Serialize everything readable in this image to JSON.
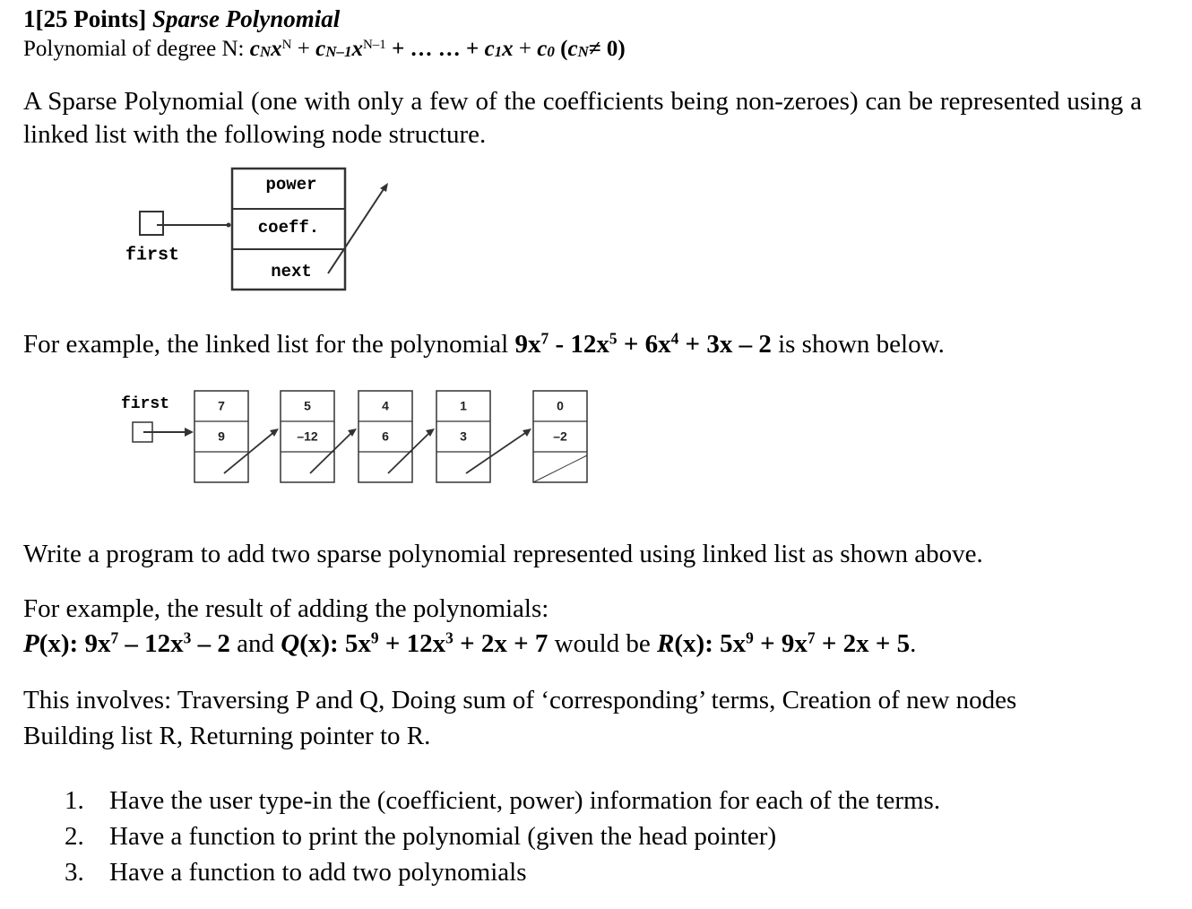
{
  "header": {
    "number": "1",
    "points": "[25 Points]",
    "title": "Sparse Polynomial"
  },
  "definition": {
    "prefix": "Polynomial of degree N: ",
    "terms": [
      {
        "coef": "c",
        "coef_sub": "N",
        "var": "x",
        "exp": "N",
        "sep": " + "
      },
      {
        "coef": "c",
        "coef_sub": "N–1",
        "var": "x",
        "exp": "N–1",
        "sep": " + … … + "
      },
      {
        "coef": "c",
        "coef_sub": "1",
        "var": "x",
        "exp": "",
        "sep": " + "
      },
      {
        "coef": "c",
        "coef_sub": "0",
        "var": "",
        "exp": "",
        "sep": ""
      }
    ],
    "condition_open": " (",
    "condition_coef": "c",
    "condition_sub": "N",
    "condition_rest": "≠ 0)"
  },
  "intro_paragraph": "A Sparse Polynomial (one with only a few of the coefficients being non-zeroes) can be represented using a linked list with the following node structure.",
  "node_structure": {
    "pointer_label": "first",
    "fields": [
      "power",
      "coeff.",
      "next"
    ]
  },
  "example": {
    "before": "For example, the linked list for the polynomial ",
    "terms": [
      {
        "coef": "9x",
        "exp": "7",
        "sep": " - "
      },
      {
        "coef": "12x",
        "exp": "5",
        "sep": " + "
      },
      {
        "coef": "6x",
        "exp": "4",
        "sep": " + "
      },
      {
        "coef": "3x",
        "exp": "",
        "sep": " – "
      },
      {
        "coef": "2",
        "exp": "",
        "sep": ""
      }
    ],
    "after": " is shown below."
  },
  "example_list": {
    "pointer_label": "first",
    "nodes": [
      {
        "power": "7",
        "coeff": "9",
        "next": "pointer"
      },
      {
        "power": "5",
        "coeff": "–12",
        "next": "pointer"
      },
      {
        "power": "4",
        "coeff": "6",
        "next": "pointer"
      },
      {
        "power": "1",
        "coeff": "3",
        "next": "pointer"
      },
      {
        "power": "0",
        "coeff": "–2",
        "next": "null"
      }
    ]
  },
  "task": "Write a program to add two sparse polynomial represented using linked list as shown above.",
  "sum_example": {
    "intro": "For example, the result of adding the polynomials:",
    "p_name": "P",
    "p_expr": [
      "9x",
      "7",
      " – 12x",
      "3",
      " – 2"
    ],
    "and": " and ",
    "q_name": "Q",
    "q_expr": [
      "5x",
      "9",
      " + 12x",
      "3",
      " + 2x + 7"
    ],
    "would_be": " would be ",
    "r_name": "R",
    "r_expr": [
      "5x",
      "9",
      " + 9x",
      "7",
      " + 2x + 5"
    ],
    "arg": "(x): ",
    "end": "."
  },
  "involves": {
    "line1": "This involves: Traversing P and Q, Doing sum of ‘corresponding’ terms, Creation of new nodes",
    "line2": "Building list R, Returning pointer to R."
  },
  "requirements": [
    {
      "num": "1.",
      "text": "Have the user type-in the (coefficient, power) information for each of the terms."
    },
    {
      "num": "2.",
      "text": "Have a function to print the polynomial (given the head pointer)"
    },
    {
      "num": "3.",
      "text": "Have a function to add two polynomials"
    }
  ]
}
